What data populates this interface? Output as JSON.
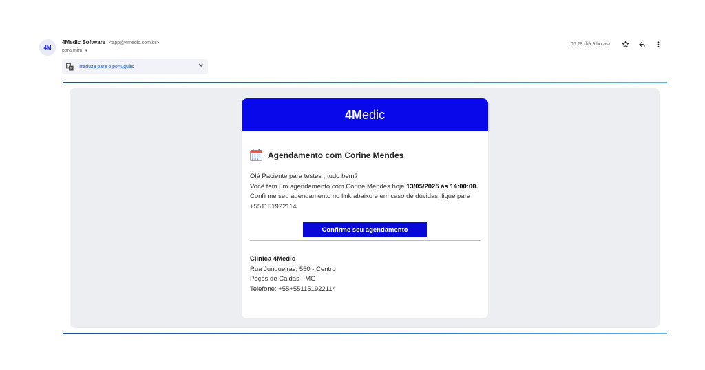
{
  "sender": {
    "avatar_text": "4M",
    "name": "4Medic Software",
    "email": "<app@4medic.com.br>",
    "to_label": "para mim"
  },
  "translate": {
    "label": "Traduza para o português",
    "close_glyph": "✕"
  },
  "meta": {
    "time": "06:28 (há 9 horas)",
    "icons": [
      "star-icon",
      "reply-icon",
      "more-vert-icon"
    ]
  },
  "email": {
    "brand_bold": "4M",
    "brand_rest": "edic",
    "title": "Agendamento com Corine Mendes",
    "line1": "Olá Paciente para testes , tudo bem?",
    "line2_prefix": "Você tem um agendamento com Corine Mendes hoje ",
    "line2_bold": "13/05/2025 às 14:00:00.",
    "line3": "Confirme seu agendamento no link abaixo e em caso de dúvidas, ligue para",
    "line4": "+551151922114",
    "button_label": "Confirme seu agendamento",
    "clinic_name": "Clinica 4Medic",
    "clinic_address": "Rua Junqueiras, 550 - Centro",
    "clinic_city": "Poços de Caldas - MG",
    "clinic_phone": "Telefone: +55+551151922114"
  },
  "colors": {
    "header_blue": "#0808ea",
    "button_blue": "#0808d8",
    "link_blue": "#1a56c9"
  }
}
